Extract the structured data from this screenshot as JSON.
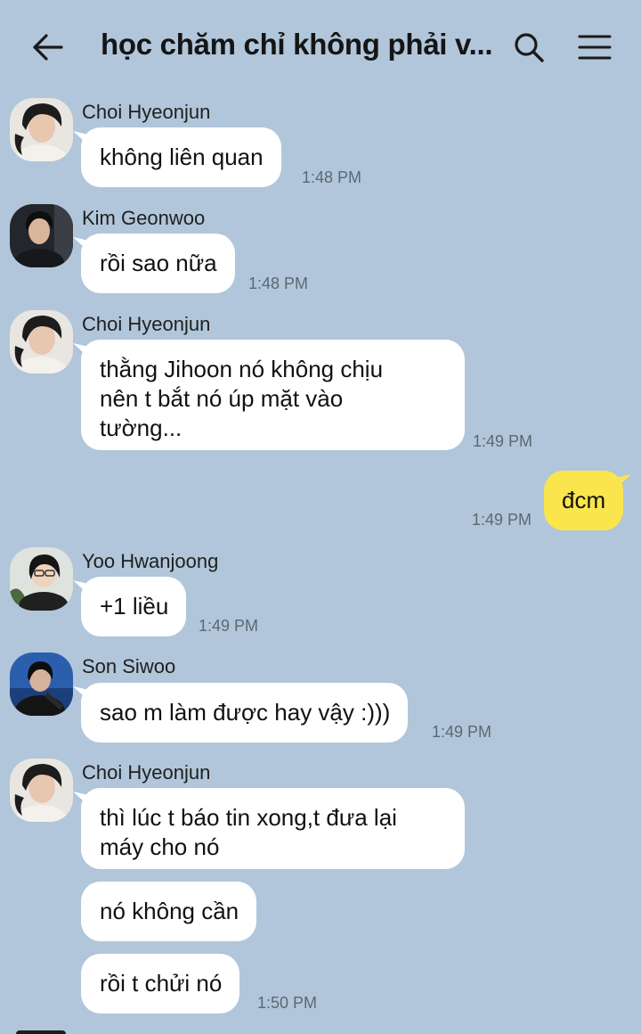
{
  "header": {
    "title": "học chăm chỉ không phải v..."
  },
  "messages": [
    {
      "sender": "Choi Hyeonjun",
      "text": "không liên quan",
      "time": "1:48 PM"
    },
    {
      "sender": "Kim Geonwoo",
      "text": "rồi sao nữa",
      "time": "1:48 PM"
    },
    {
      "sender": "Choi Hyeonjun",
      "lines": [
        "thằng Jihoon nó không chịu",
        "nên t bắt nó úp mặt vào",
        "tường..."
      ],
      "time": "1:49 PM"
    },
    {
      "sender": "me",
      "text": "đcm",
      "time": "1:49 PM"
    },
    {
      "sender": "Yoo Hwanjoong",
      "text": "+1 liều",
      "time": "1:49 PM"
    },
    {
      "sender": "Son Siwoo",
      "text": "sao m làm được hay vậy :)))",
      "time": "1:49 PM"
    },
    {
      "sender": "Choi Hyeonjun",
      "lines": [
        "thì lúc t báo tin xong,t đưa lại",
        "máy cho nó"
      ]
    },
    {
      "sender": "Choi Hyeonjun",
      "text": "nó không cần"
    },
    {
      "sender": "Choi Hyeonjun",
      "text": "rồi t chửi nó",
      "time": "1:50 PM"
    }
  ],
  "colors": {
    "background": "#b1c6da",
    "incoming_bubble": "#ffffff",
    "outgoing_bubble": "#fbe54d",
    "timestamp": "#5d6873"
  },
  "icons": [
    "back-arrow-icon",
    "search-icon",
    "menu-icon"
  ]
}
